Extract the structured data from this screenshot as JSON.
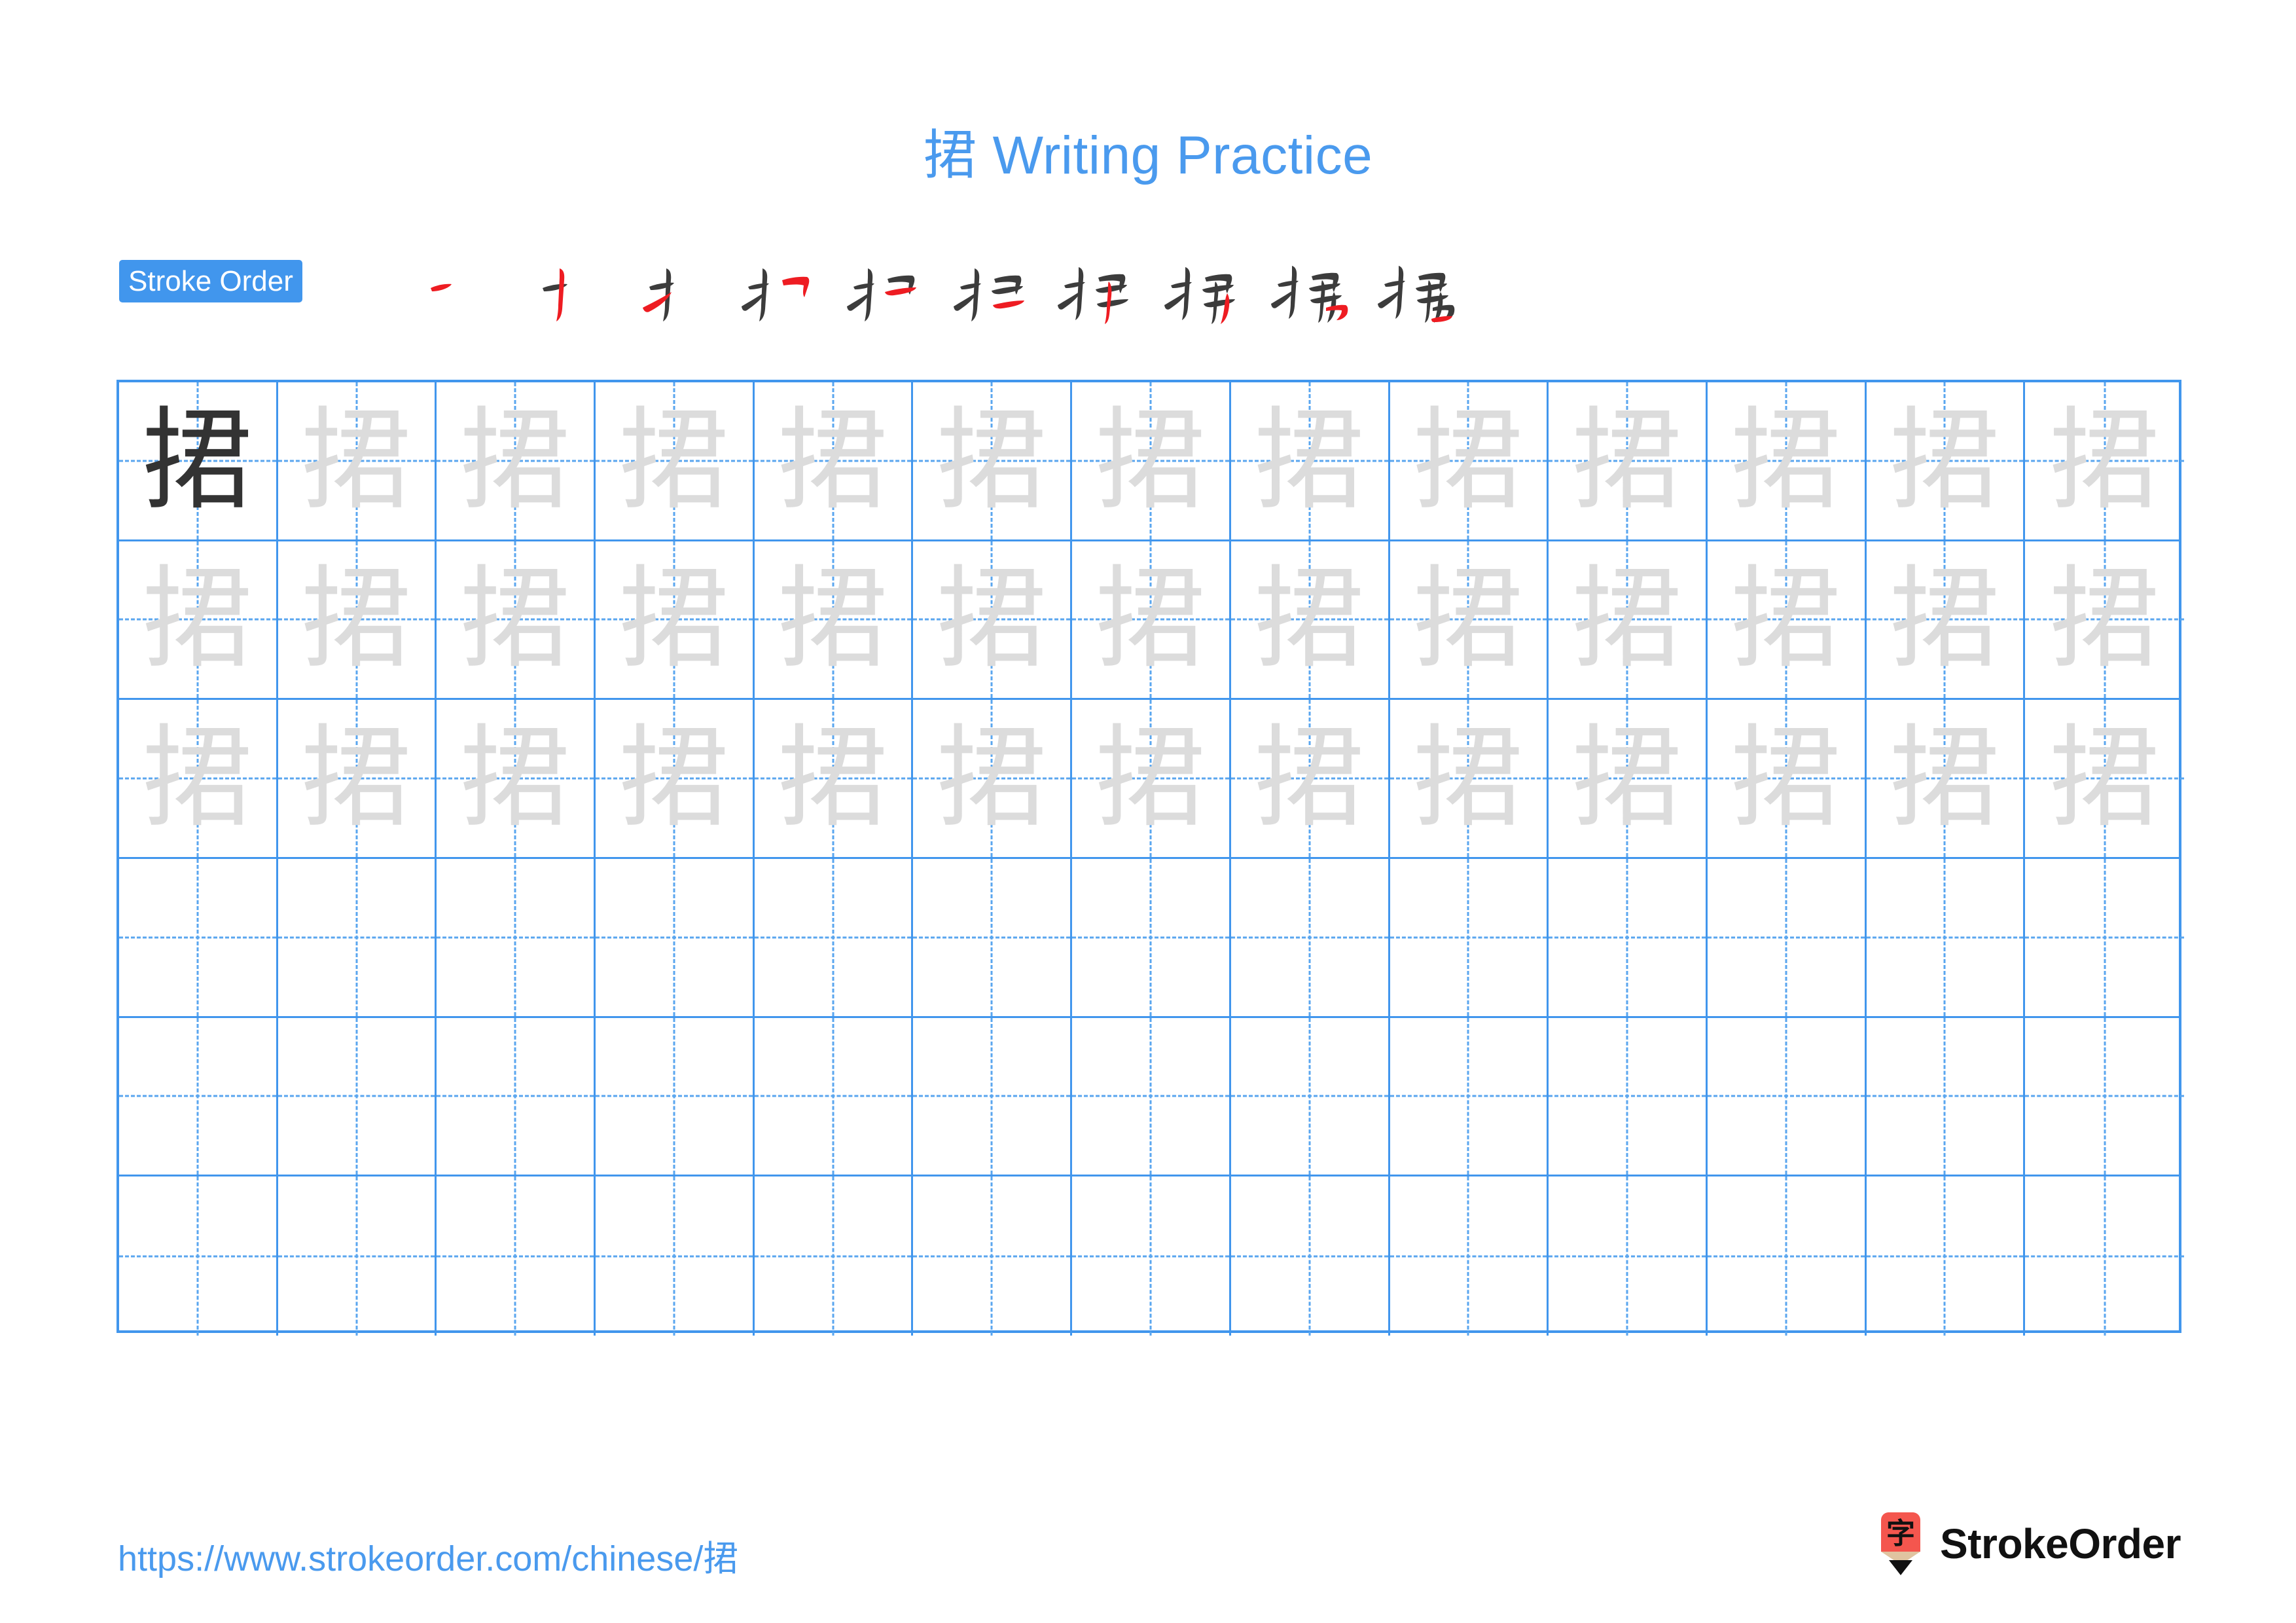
{
  "page": {
    "character": "捃",
    "title": "捃 Writing Practice",
    "background_color": "#ffffff"
  },
  "header": {
    "title_prefix": "捃",
    "title_text": " Writing Practice",
    "title_full": "捃 Writing Practice",
    "title_color": "#4a9aee"
  },
  "stroke_order": {
    "badge_label": "Stroke Order",
    "badge_bg_color": "#4196ed",
    "badge_text_color": "#ffffff",
    "total_strokes": 10,
    "new_stroke_color": "#ee1c22",
    "existing_stroke_color": "#3c3c3c",
    "steps": [
      {
        "index": 1,
        "partial": "一"
      },
      {
        "index": 2,
        "partial": "丁"
      },
      {
        "index": 3,
        "partial": "扌"
      },
      {
        "index": 4,
        "partial": "扌丿"
      },
      {
        "index": 5,
        "partial": "扌コ"
      },
      {
        "index": 6,
        "partial": "扫"
      },
      {
        "index": 7,
        "partial": "抻"
      },
      {
        "index": 8,
        "partial": "押"
      },
      {
        "index": 9,
        "partial": "捃"
      },
      {
        "index": 10,
        "partial": "捃"
      }
    ]
  },
  "grid": {
    "columns": 13,
    "rows": 6,
    "line_color": "#4196ed",
    "guide_color": "#5aa6ef",
    "dark_char_color": "#333333",
    "trace_char_color": "#dcdcdc",
    "cells": [
      [
        "dark",
        "trace",
        "trace",
        "trace",
        "trace",
        "trace",
        "trace",
        "trace",
        "trace",
        "trace",
        "trace",
        "trace",
        "trace"
      ],
      [
        "trace",
        "trace",
        "trace",
        "trace",
        "trace",
        "trace",
        "trace",
        "trace",
        "trace",
        "trace",
        "trace",
        "trace",
        "trace"
      ],
      [
        "trace",
        "trace",
        "trace",
        "trace",
        "trace",
        "trace",
        "trace",
        "trace",
        "trace",
        "trace",
        "trace",
        "trace",
        "trace"
      ],
      [
        "blank",
        "blank",
        "blank",
        "blank",
        "blank",
        "blank",
        "blank",
        "blank",
        "blank",
        "blank",
        "blank",
        "blank",
        "blank"
      ],
      [
        "blank",
        "blank",
        "blank",
        "blank",
        "blank",
        "blank",
        "blank",
        "blank",
        "blank",
        "blank",
        "blank",
        "blank",
        "blank"
      ],
      [
        "blank",
        "blank",
        "blank",
        "blank",
        "blank",
        "blank",
        "blank",
        "blank",
        "blank",
        "blank",
        "blank",
        "blank",
        "blank"
      ]
    ]
  },
  "footer": {
    "url": "https://www.strokeorder.com/chinese/捃",
    "url_color": "#4a9aee",
    "logo_text": "StrokeOrder",
    "logo_glyph": "字",
    "logo_body_color": "#f4564e",
    "logo_wood_color": "#e0c4a0",
    "logo_tip_color": "#111111"
  }
}
